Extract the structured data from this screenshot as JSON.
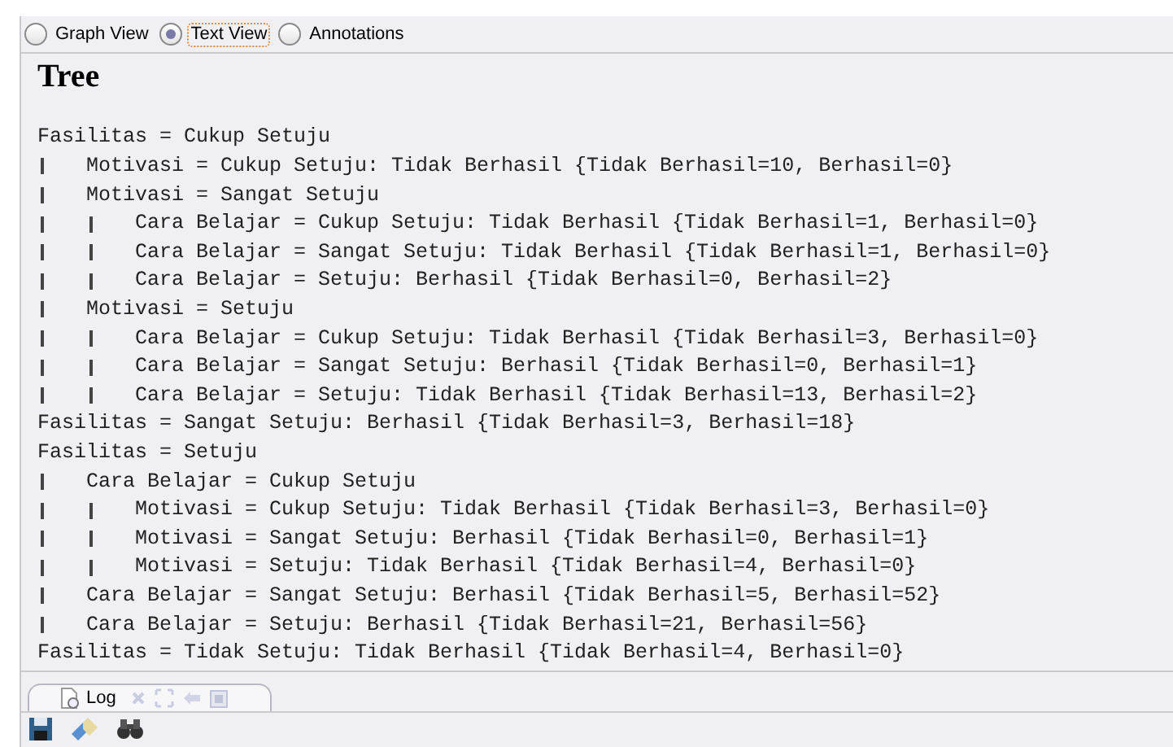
{
  "view_options": [
    {
      "label": "Graph View",
      "selected": false,
      "focused": false
    },
    {
      "label": "Text View",
      "selected": true,
      "focused": true
    },
    {
      "label": "Annotations",
      "selected": false,
      "focused": false
    }
  ],
  "heading": "Tree",
  "tree": [
    {
      "text": "Fasilitas = Cukup Setuju",
      "children": [
        {
          "text": "Motivasi = Cukup Setuju: Tidak Berhasil {Tidak Berhasil=10, Berhasil=0}"
        },
        {
          "text": "Motivasi = Sangat Setuju",
          "children": [
            {
              "text": "Cara Belajar = Cukup Setuju: Tidak Berhasil {Tidak Berhasil=1, Berhasil=0}"
            },
            {
              "text": "Cara Belajar = Sangat Setuju: Tidak Berhasil {Tidak Berhasil=1, Berhasil=0}"
            },
            {
              "text": "Cara Belajar = Setuju: Berhasil {Tidak Berhasil=0, Berhasil=2}"
            }
          ]
        },
        {
          "text": "Motivasi = Setuju",
          "children": [
            {
              "text": "Cara Belajar = Cukup Setuju: Tidak Berhasil {Tidak Berhasil=3, Berhasil=0}"
            },
            {
              "text": "Cara Belajar = Sangat Setuju: Berhasil {Tidak Berhasil=0, Berhasil=1}"
            },
            {
              "text": "Cara Belajar = Setuju: Tidak Berhasil {Tidak Berhasil=13, Berhasil=2}"
            }
          ]
        }
      ]
    },
    {
      "text": "Fasilitas = Sangat Setuju: Berhasil {Tidak Berhasil=3, Berhasil=18}"
    },
    {
      "text": "Fasilitas = Setuju",
      "children": [
        {
          "text": "Cara Belajar = Cukup Setuju",
          "children": [
            {
              "text": "Motivasi = Cukup Setuju: Tidak Berhasil {Tidak Berhasil=3, Berhasil=0}"
            },
            {
              "text": "Motivasi = Sangat Setuju: Berhasil {Tidak Berhasil=0, Berhasil=1}"
            },
            {
              "text": "Motivasi = Setuju: Tidak Berhasil {Tidak Berhasil=4, Berhasil=0}"
            }
          ]
        },
        {
          "text": "Cara Belajar = Sangat Setuju: Berhasil {Tidak Berhasil=5, Berhasil=52}"
        },
        {
          "text": "Cara Belajar = Setuju: Berhasil {Tidak Berhasil=21, Berhasil=56}"
        }
      ]
    },
    {
      "text": "Fasilitas = Tidak Setuju: Tidak Berhasil {Tidak Berhasil=4, Berhasil=0}"
    }
  ],
  "log_tab": {
    "label": "Log"
  }
}
